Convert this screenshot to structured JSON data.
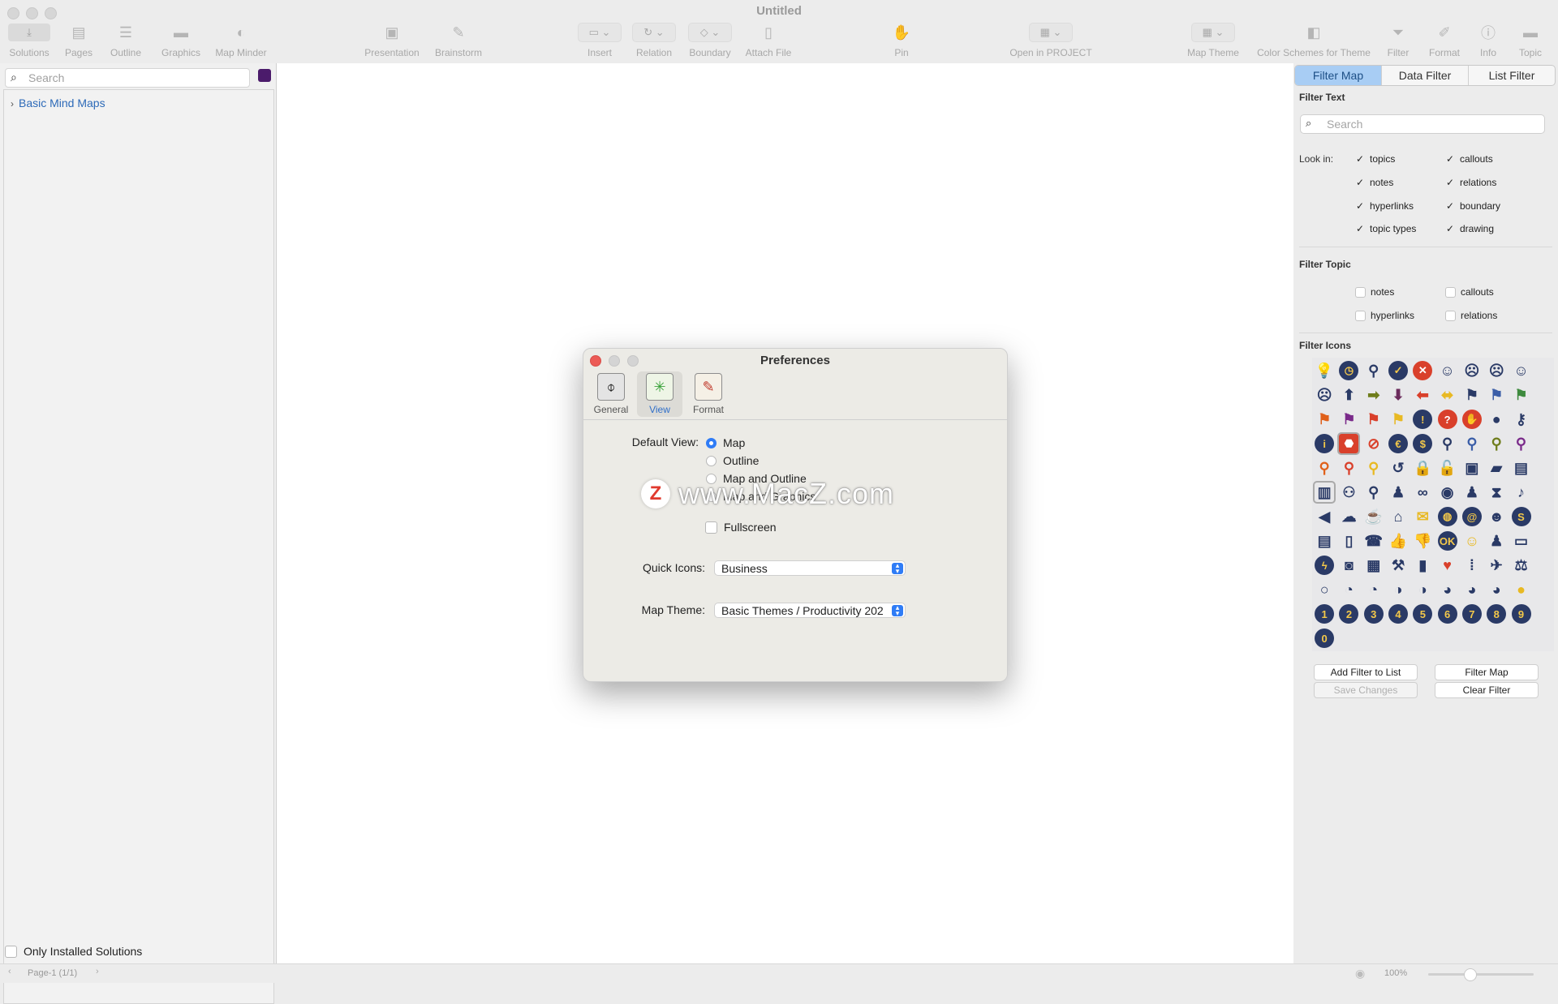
{
  "window": {
    "title": "Untitled"
  },
  "toolbar": {
    "left": [
      {
        "label": "Solutions",
        "icon": "solutions-icon"
      },
      {
        "label": "Pages",
        "icon": "pages-icon"
      },
      {
        "label": "Outline",
        "icon": "outline-icon"
      },
      {
        "label": "Graphics",
        "icon": "graphics-icon"
      },
      {
        "label": "Map Minder",
        "icon": "map-minder-icon"
      }
    ],
    "center": [
      {
        "label": "Presentation"
      },
      {
        "label": "Brainstorm"
      },
      {
        "label": "Insert"
      },
      {
        "label": "Relation"
      },
      {
        "label": "Boundary"
      },
      {
        "label": "Attach File"
      },
      {
        "label": "Pin"
      },
      {
        "label": "Open in PROJECT"
      }
    ],
    "right": [
      {
        "label": "Map Theme"
      },
      {
        "label": "Color Schemes for Theme"
      },
      {
        "label": "Filter"
      },
      {
        "label": "Format"
      },
      {
        "label": "Info"
      },
      {
        "label": "Topic"
      }
    ]
  },
  "sidebar": {
    "search_placeholder": "Search",
    "tree": [
      {
        "label": "Basic Mind Maps"
      }
    ],
    "only_installed_label": "Only Installed Solutions"
  },
  "status": {
    "page": "Page-1 (1/1)",
    "zoom": "100%"
  },
  "filter_panel": {
    "tabs": [
      "Filter Map",
      "Data Filter",
      "List Filter"
    ],
    "active_tab": "Filter Map",
    "filter_text_heading": "Filter Text",
    "search_placeholder": "Search",
    "look_in_label": "Look in:",
    "look_in": [
      {
        "label": "topics",
        "checked": true
      },
      {
        "label": "callouts",
        "checked": true
      },
      {
        "label": "notes",
        "checked": true
      },
      {
        "label": "relations",
        "checked": true
      },
      {
        "label": "hyperlinks",
        "checked": true
      },
      {
        "label": "boundary",
        "checked": true
      },
      {
        "label": "topic types",
        "checked": true
      },
      {
        "label": "drawing",
        "checked": true
      }
    ],
    "filter_topic_heading": "Filter Topic",
    "filter_topic": [
      {
        "label": "notes",
        "checked": false
      },
      {
        "label": "callouts",
        "checked": false
      },
      {
        "label": "hyperlinks",
        "checked": false
      },
      {
        "label": "relations",
        "checked": false
      }
    ],
    "filter_icons_heading": "Filter Icons",
    "buttons": {
      "add_filter": "Add Filter to List",
      "filter_map": "Filter Map",
      "save_changes": "Save Changes",
      "clear_filter": "Clear Filter"
    }
  },
  "preferences": {
    "title": "Preferences",
    "tabs": [
      {
        "label": "General",
        "icon": "general-tab-icon"
      },
      {
        "label": "View",
        "icon": "view-tab-icon"
      },
      {
        "label": "Format",
        "icon": "format-tab-icon"
      }
    ],
    "active_tab": "View",
    "default_view_label": "Default View:",
    "default_view_options": [
      "Map",
      "Outline",
      "Map and Outline",
      "Map and Graphics"
    ],
    "default_view_selected": "Map",
    "fullscreen_label": "Fullscreen",
    "quick_icons_label": "Quick Icons:",
    "quick_icons_value": "Business",
    "map_theme_label": "Map Theme:",
    "map_theme_value": "Basic Themes / Productivity 202"
  },
  "watermark": {
    "logo": "Z",
    "text": "www.MacZ.com"
  },
  "colors": {
    "accent": "#2f7cf6",
    "tab_active": "#a8cdf4",
    "link": "#2d6ab8"
  }
}
